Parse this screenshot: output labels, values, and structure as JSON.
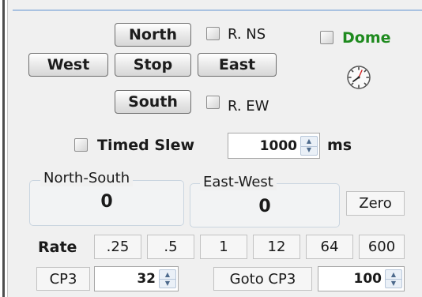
{
  "direction": {
    "north": "North",
    "west": "West",
    "stop": "Stop",
    "east": "East",
    "south": "South"
  },
  "reverse": {
    "ns_label": "R. NS",
    "ew_label": "R. EW",
    "ns_checked": false,
    "ew_checked": false
  },
  "dome": {
    "label": "Dome",
    "checked": false,
    "color": "#1e8a1e"
  },
  "clock_icon": "clock-icon",
  "timed_slew": {
    "label": "Timed Slew",
    "checked": false,
    "value": "1000",
    "unit": "ms"
  },
  "north_south": {
    "title": "North-South",
    "value": "0"
  },
  "east_west": {
    "title": "East-West",
    "value": "0"
  },
  "zero_label": "Zero",
  "rate": {
    "label": "Rate",
    "values": [
      ".25",
      ".5",
      "1",
      "12",
      "64",
      "600"
    ]
  },
  "cp3": {
    "label": "CP3",
    "value": "32"
  },
  "goto_cp3": {
    "label": "Goto CP3",
    "value": "100"
  },
  "colors": {
    "accent_line": "#a9c2e1",
    "group_border": "#cad5e0"
  }
}
